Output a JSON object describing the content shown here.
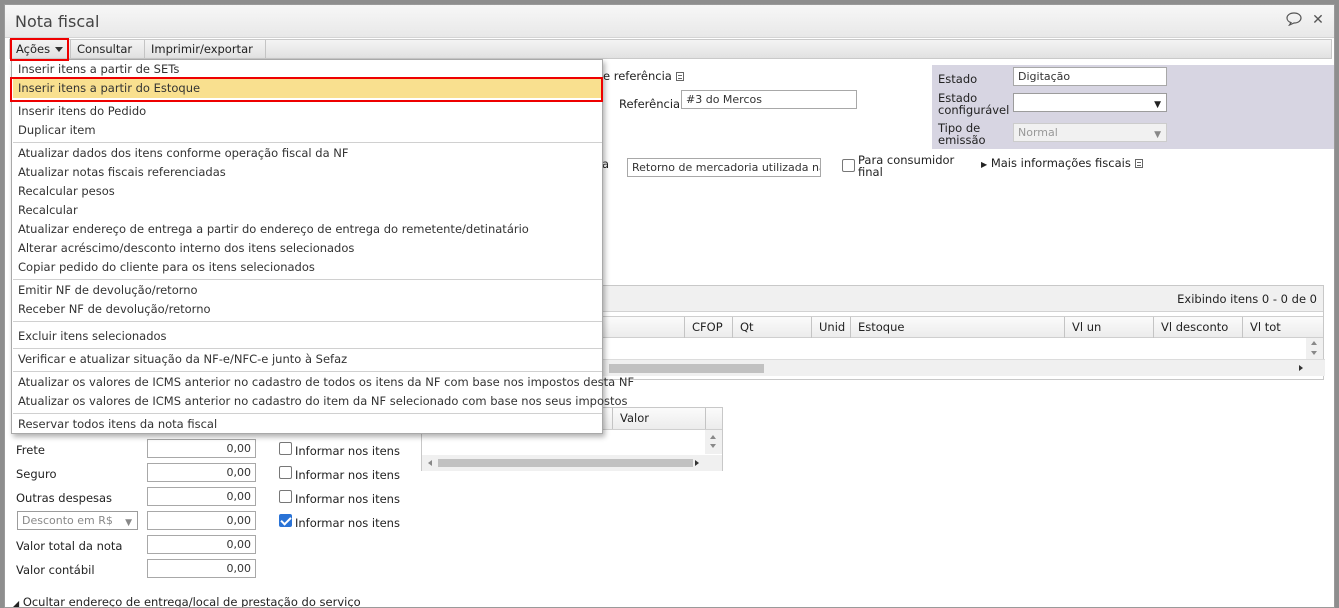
{
  "window": {
    "title": "Nota fiscal",
    "icons": [
      "comment-icon",
      "close-icon"
    ]
  },
  "menubar": {
    "acoes": "Ações",
    "consultar": "Consultar",
    "imprimir": "Imprimir/exportar"
  },
  "dropdown": {
    "items": [
      "Inserir itens a partir de SETs",
      "Inserir itens a partir do Estoque",
      "Inserir itens do Pedido",
      "Duplicar item",
      "Atualizar dados dos itens conforme operação fiscal da NF",
      "Atualizar notas fiscais referenciadas",
      "Recalcular pesos",
      "Recalcular",
      "Atualizar endereço de entrega a partir do endereço de entrega do remetente/detinatário",
      "Alterar acréscimo/desconto interno dos itens selecionados",
      "Copiar pedido do cliente para os itens selecionados",
      "Emitir NF de devolução/retorno",
      "Receber NF de devolução/retorno",
      "Excluir itens selecionados",
      "Verificar e atualizar situação da NF-e/NFC-e junto à Sefaz",
      "Atualizar os valores de ICMS anterior no cadastro de todos os itens da NF com base nos impostos desta NF",
      "Atualizar os valores de ICMS anterior no cadastro do item da NF selecionado com base nos seus impostos",
      "Reservar todos itens da nota fiscal"
    ]
  },
  "header": {
    "referencia_link": "e referência",
    "referencia_label": "Referência",
    "referencia_value": "#3 do Mercos",
    "natureza_value": "Retorno de mercadoria utilizada na",
    "natureza_trunc": "a",
    "consumidor_final_label_1": "Para consumidor",
    "consumidor_final_label_2": "final",
    "mais_info": "Mais informações fiscais"
  },
  "estado": {
    "estado_label": "Estado",
    "estado_value": "Digitação",
    "configuravel_label_1": "Estado",
    "configuravel_label_2": "configurável",
    "configuravel_value": "",
    "tipo_label_1": "Tipo de",
    "tipo_label_2": "emissão",
    "tipo_value": "Normal"
  },
  "items_grid": {
    "exibindo": "Exibindo itens 0 - 0 de 0",
    "columns": [
      "CFOP",
      "Qt",
      "Unid",
      "Estoque",
      "Vl un",
      "Vl desconto",
      "Vl tot"
    ]
  },
  "small_grid": {
    "column": "Valor"
  },
  "totals": {
    "frete_label": "Frete",
    "frete_value": "0,00",
    "seguro_label": "Seguro",
    "seguro_value": "0,00",
    "outras_label": "Outras despesas",
    "outras_value": "0,00",
    "desconto_select": "Desconto em R$",
    "desconto_value": "0,00",
    "total_label": "Valor total da nota",
    "total_value": "0,00",
    "contabil_label": "Valor contábil",
    "contabil_value": "0,00",
    "informar_label": "Informar nos itens",
    "informar_checked": [
      false,
      false,
      false,
      true
    ]
  },
  "footer": {
    "ocultar_endereco": "Ocultar endereço de entrega/local de prestação do serviço"
  },
  "colors": {
    "highlight": "#f9e08f",
    "red_annotation": "#e00000",
    "estado_panel": "#d7d5e2",
    "checkbox_checked": "#2a73d6"
  }
}
